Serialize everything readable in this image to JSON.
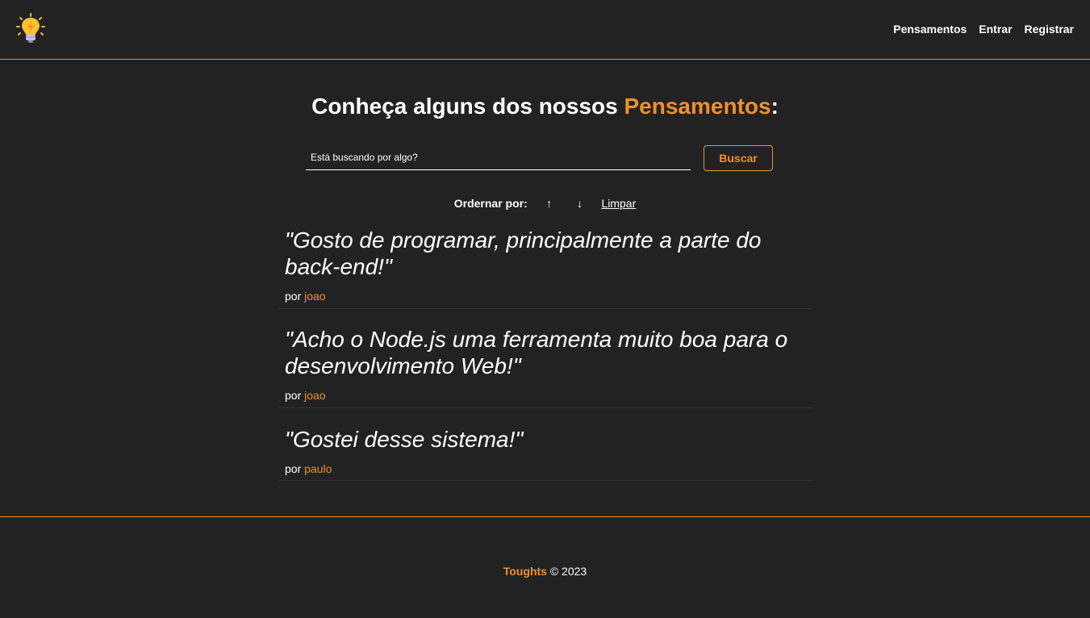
{
  "nav": {
    "logo_icon": "lightbulb-icon",
    "links": [
      "Pensamentos",
      "Entrar",
      "Registrar"
    ]
  },
  "main": {
    "heading_prefix": "Conheça alguns dos nossos ",
    "heading_accent": "Pensamentos",
    "heading_suffix": ":",
    "search": {
      "placeholder": "Está buscando por algo?",
      "value": "",
      "button_label": "Buscar"
    },
    "order": {
      "label": "Ordernar por:",
      "asc_icon": "↑",
      "desc_icon": "↓",
      "clear_label": "Limpar"
    },
    "author_prefix": "por",
    "thoughts": [
      {
        "text": "\"Gosto de programar, principalmente a parte do back-end!\"",
        "author": "joao"
      },
      {
        "text": "\"Acho o Node.js uma ferramenta muito boa para o desenvolvimento Web!\"",
        "author": "joao"
      },
      {
        "text": "\"Gostei desse sistema!\"",
        "author": "paulo"
      }
    ]
  },
  "footer": {
    "brand": "Toughts",
    "copyright": "© 2023"
  },
  "colors": {
    "background": "#222222",
    "accent": "#f0902c",
    "text": "#ffffff"
  }
}
